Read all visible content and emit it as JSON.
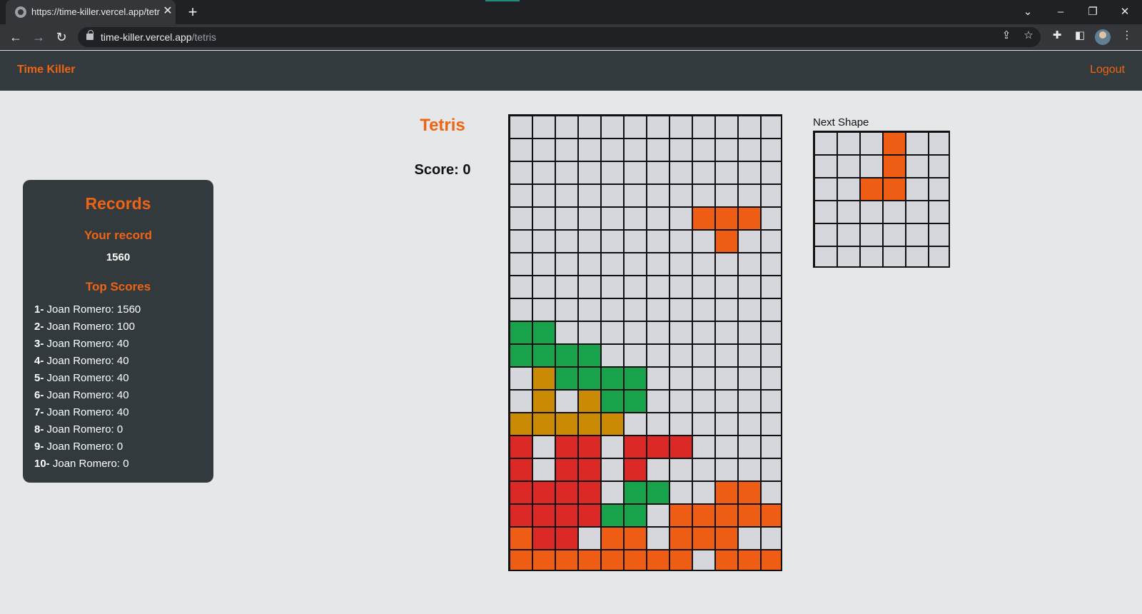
{
  "browser": {
    "tab_title": "https://time-killer.vercel.app/tetris",
    "url_host": "time-killer.vercel.app",
    "url_path": "/tetris",
    "new_tab": "+",
    "close": "✕"
  },
  "app": {
    "brand": "Time Killer",
    "logout": "Logout"
  },
  "records": {
    "title": "Records",
    "your_record_label": "Your record",
    "your_record_value": "1560",
    "top_scores_label": "Top Scores",
    "top_scores": [
      {
        "rank": "1-",
        "text": " Joan Romero: 1560"
      },
      {
        "rank": "2-",
        "text": " Joan Romero: 100"
      },
      {
        "rank": "3-",
        "text": " Joan Romero: 40"
      },
      {
        "rank": "4-",
        "text": " Joan Romero: 40"
      },
      {
        "rank": "5-",
        "text": " Joan Romero: 40"
      },
      {
        "rank": "6-",
        "text": " Joan Romero: 40"
      },
      {
        "rank": "7-",
        "text": " Joan Romero: 40"
      },
      {
        "rank": "8-",
        "text": " Joan Romero: 0"
      },
      {
        "rank": "9-",
        "text": " Joan Romero: 0"
      },
      {
        "rank": "10-",
        "text": " Joan Romero: 0"
      }
    ]
  },
  "game": {
    "title": "Tetris",
    "score_text": "Score: 0",
    "next_shape_label": "Next Shape",
    "colors": {
      ".": "#d6d7dc",
      "O": "#ef5d14",
      "G": "#17a24b",
      "Y": "#cb8a03",
      "R": "#dd2828"
    },
    "board": [
      "............",
      "............",
      "............",
      "............",
      "........OOO.",
      ".........O..",
      "............",
      "............",
      "............",
      "GG..........",
      "GGGG........",
      ".YGGGG......",
      ".Y.YGG......",
      "YYYYY.......",
      "R.RR.RRR....",
      "R.RR.R......",
      "RRRR.GG..OO.",
      "RRRRGG.OOOOO",
      "ORR.OO.OOO..",
      "OOOOOOOO.OOO"
    ],
    "next_shape": [
      "...O..",
      "...O..",
      "..OO..",
      "......",
      "......",
      "......"
    ]
  }
}
